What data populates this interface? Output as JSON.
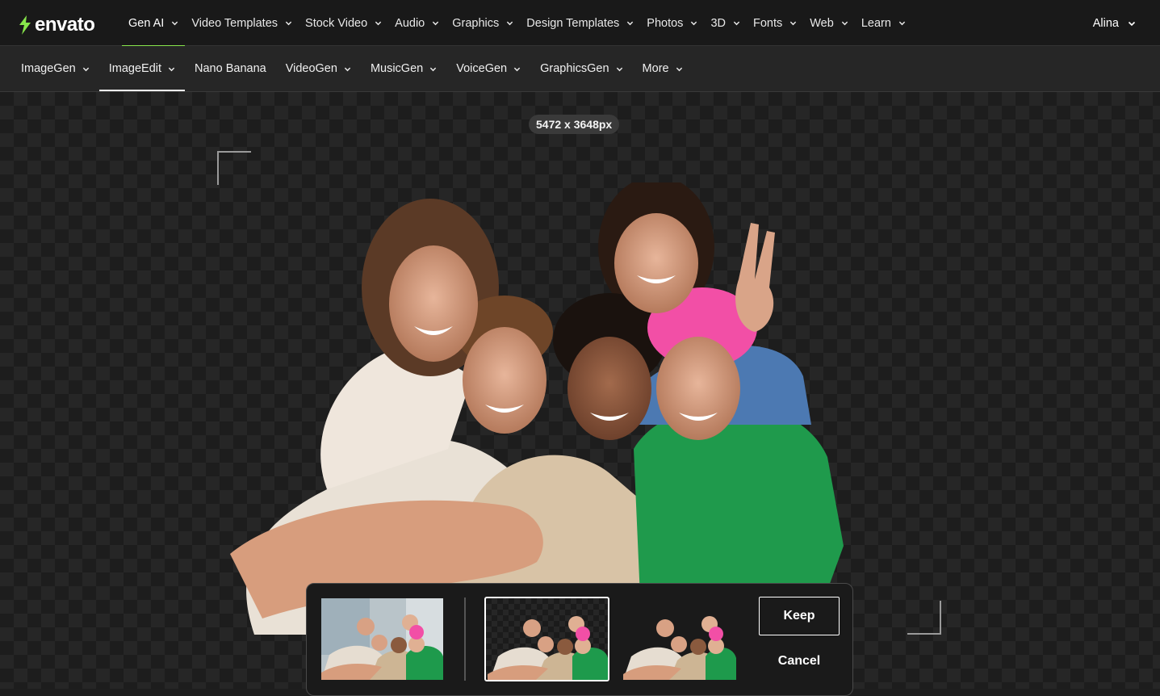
{
  "brand": {
    "name": "envato",
    "accent": "#87e64b",
    "icon": "envato-leaf-icon"
  },
  "topnav": {
    "items": [
      {
        "label": "Gen AI",
        "active": true
      },
      {
        "label": "Video Templates"
      },
      {
        "label": "Stock Video"
      },
      {
        "label": "Audio"
      },
      {
        "label": "Graphics"
      },
      {
        "label": "Design Templates"
      },
      {
        "label": "Photos"
      },
      {
        "label": "3D"
      },
      {
        "label": "Fonts"
      },
      {
        "label": "Web"
      },
      {
        "label": "Learn"
      }
    ],
    "user": "Alina"
  },
  "subnav": {
    "items": [
      {
        "label": "ImageGen",
        "dropdown": true
      },
      {
        "label": "ImageEdit",
        "dropdown": true,
        "active": true
      },
      {
        "label": "Nano Banana",
        "dropdown": false
      },
      {
        "label": "VideoGen",
        "dropdown": true
      },
      {
        "label": "MusicGen",
        "dropdown": true
      },
      {
        "label": "VoiceGen",
        "dropdown": true
      },
      {
        "label": "GraphicsGen",
        "dropdown": true
      },
      {
        "label": "More",
        "dropdown": true
      }
    ]
  },
  "canvas": {
    "dimensions": "5472 x 3648px"
  },
  "panel": {
    "keep_label": "Keep",
    "cancel_label": "Cancel"
  }
}
